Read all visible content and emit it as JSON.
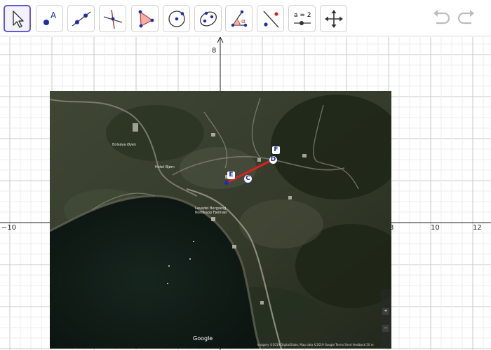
{
  "toolbar": {
    "tools": [
      {
        "name": "move-tool",
        "selected": true
      },
      {
        "name": "point-tool",
        "letter": "A"
      },
      {
        "name": "line-tool"
      },
      {
        "name": "perpendicular-line-tool"
      },
      {
        "name": "polygon-tool"
      },
      {
        "name": "circle-tool"
      },
      {
        "name": "ellipse-tool"
      },
      {
        "name": "angle-tool",
        "symbol": "α"
      },
      {
        "name": "reflect-tool"
      },
      {
        "name": "slider-tool",
        "label": "a = 2"
      },
      {
        "name": "move-graphics-view-tool"
      }
    ],
    "undo": "undo",
    "redo": "redo"
  },
  "axes": {
    "x_labels": [
      "−10",
      "8",
      "10",
      "12"
    ],
    "y_labels": [
      "8"
    ]
  },
  "map": {
    "labels": [
      "Bolsøya Øyen",
      "Hotel Bjørn",
      "Lavadel Bergskog",
      "Nordkapp Fjellnær"
    ],
    "google": "Google",
    "footer": "Imagery ©2019 DigitalGlobe, Map data ©2019 Google   Terms   Send feedback   50 m",
    "zoom_plus": "+",
    "zoom_minus": "−"
  },
  "points": {
    "E": "E",
    "C": "C",
    "F": "F",
    "D": "D"
  },
  "colors": {
    "accent": "#6557d2",
    "point": "#1a2fa8",
    "segment": "#e02020",
    "grid_minor": "#ececec",
    "grid_major": "#c9c9c9"
  }
}
